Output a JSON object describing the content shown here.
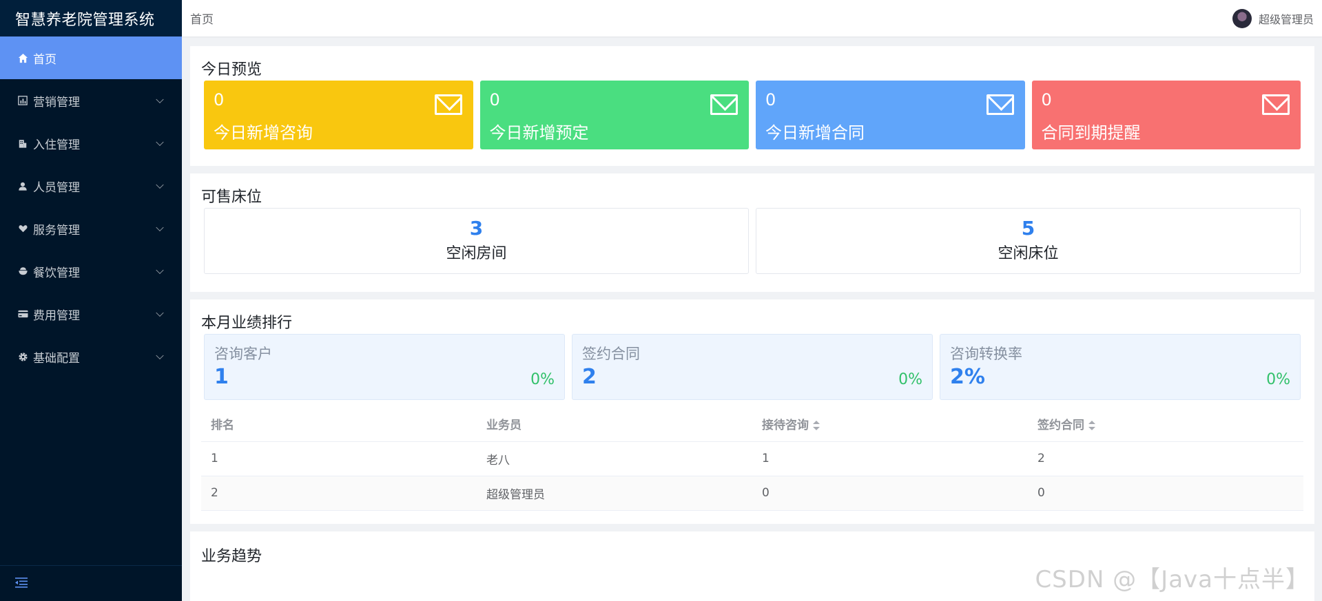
{
  "app": {
    "title": "智慧养老院管理系统"
  },
  "sidebar": {
    "items": [
      {
        "label": "首页",
        "icon": "home-icon",
        "active": true
      },
      {
        "label": "营销管理",
        "icon": "chart-icon"
      },
      {
        "label": "入住管理",
        "icon": "building-icon"
      },
      {
        "label": "人员管理",
        "icon": "person-icon"
      },
      {
        "label": "服务管理",
        "icon": "heart-hand-icon"
      },
      {
        "label": "餐饮管理",
        "icon": "bowl-icon"
      },
      {
        "label": "费用管理",
        "icon": "card-icon"
      },
      {
        "label": "基础配置",
        "icon": "gear-icon"
      }
    ]
  },
  "header": {
    "breadcrumb": "首页",
    "user_name": "超级管理员"
  },
  "today": {
    "title": "今日预览",
    "cards": [
      {
        "value": "0",
        "label": "今日新增咨询",
        "color": "#f9c70f"
      },
      {
        "value": "0",
        "label": "今日新增预定",
        "color": "#4ade80"
      },
      {
        "value": "0",
        "label": "今日新增合同",
        "color": "#60a5fa"
      },
      {
        "value": "0",
        "label": "合同到期提醒",
        "color": "#f87171"
      }
    ]
  },
  "beds": {
    "title": "可售床位",
    "items": [
      {
        "value": "3",
        "label": "空闲房间"
      },
      {
        "value": "5",
        "label": "空闲床位"
      }
    ]
  },
  "ranking": {
    "title": "本月业绩排行",
    "stats": [
      {
        "label": "咨询客户",
        "value": "1",
        "percent": "0%"
      },
      {
        "label": "签约合同",
        "value": "2",
        "percent": "0%"
      },
      {
        "label": "咨询转换率",
        "value": "2%",
        "percent": "0%"
      }
    ],
    "columns": [
      "排名",
      "业务员",
      "接待咨询",
      "签约合同"
    ],
    "rows": [
      [
        "1",
        "老八",
        "1",
        "2"
      ],
      [
        "2",
        "超级管理员",
        "0",
        "0"
      ]
    ]
  },
  "trend": {
    "title": "业务趋势"
  },
  "watermark": "CSDN @【Java十点半】"
}
